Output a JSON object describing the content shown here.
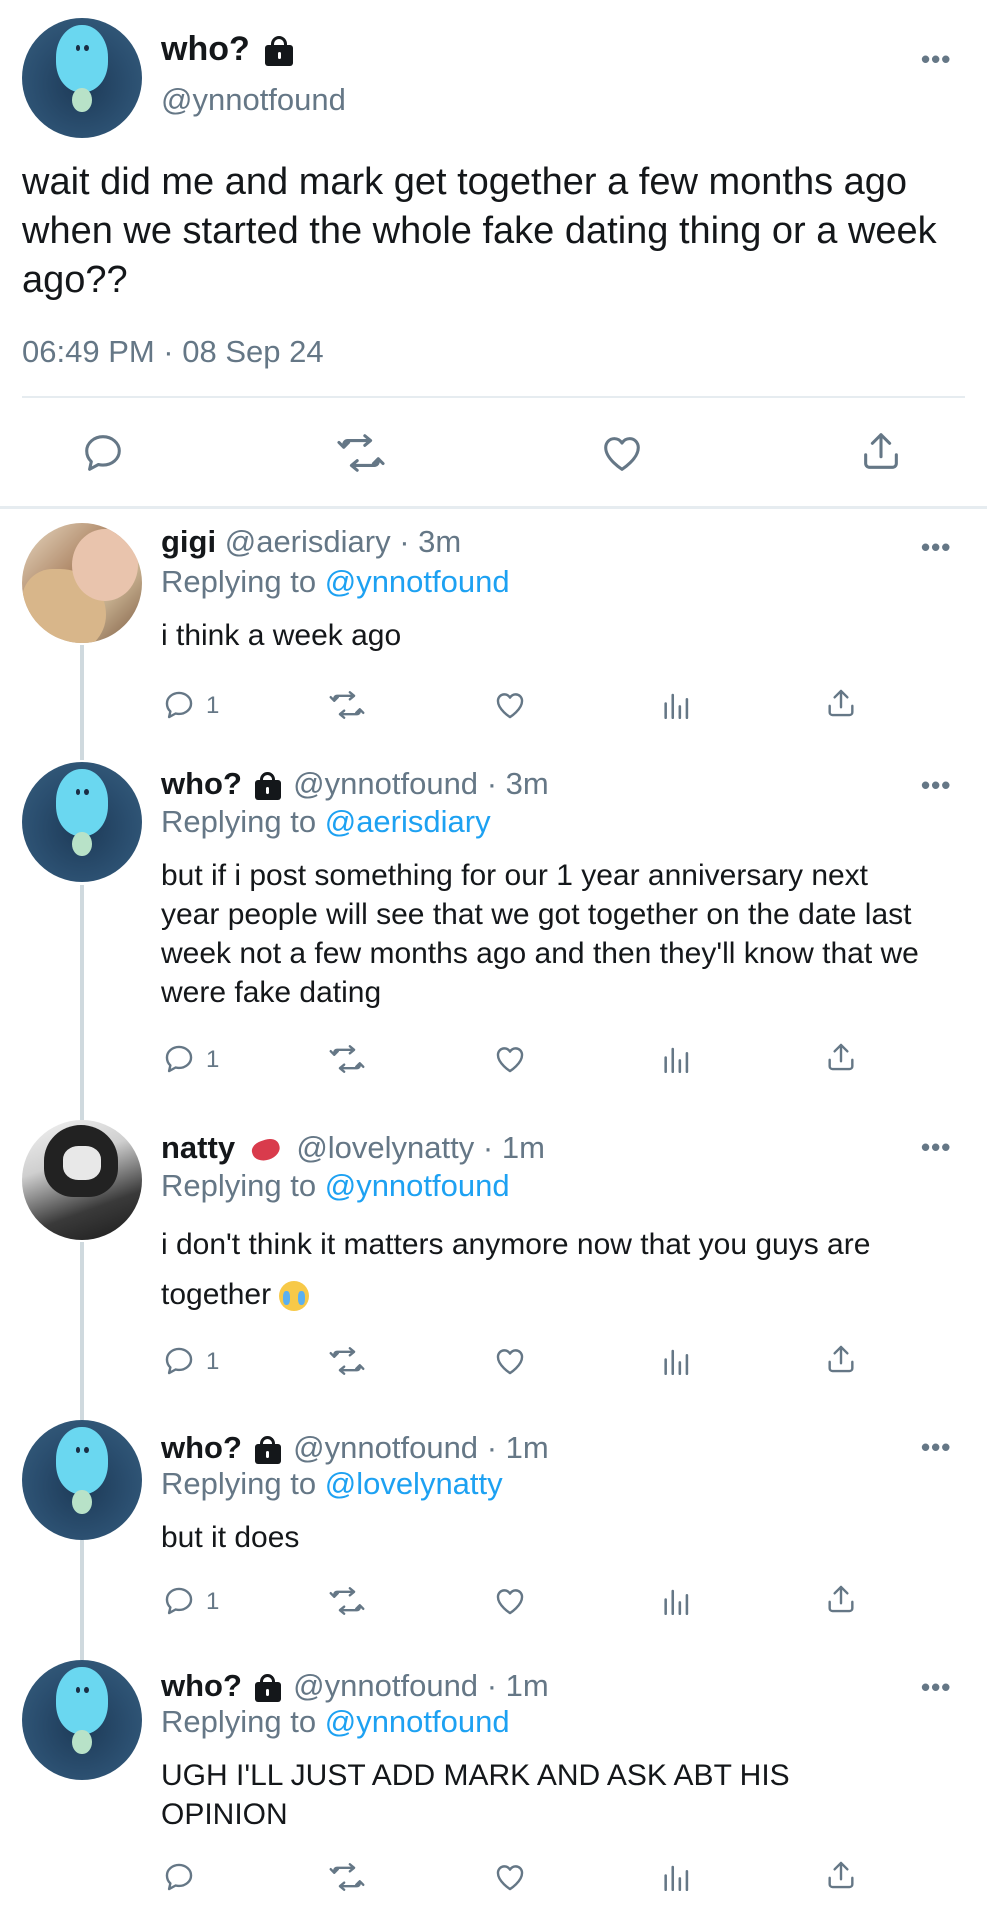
{
  "main_tweet": {
    "display_name": "who?",
    "handle": "@ynnotfound",
    "text": "wait did me and mark get together a few months ago when we started the whole fake dating thing or a week ago??",
    "timestamp": "06:49 PM · 08 Sep 24",
    "more_label": "•••",
    "actions": [
      "reply-icon",
      "retweet-icon",
      "like-icon",
      "share-icon"
    ]
  },
  "replies": [
    {
      "display_name": "gigi",
      "handle": "@aerisdiary",
      "age": "· 3m",
      "replying_prefix": "Replying to",
      "replying_to": "@ynnotfound",
      "text": "i think a week ago",
      "reply_count": "1",
      "more_label": "•••"
    },
    {
      "display_name": "who?",
      "handle": "@ynnotfound",
      "age": "· 3m",
      "replying_prefix": "Replying to",
      "replying_to": "@aerisdiary",
      "text": "but if i post something for our 1 year anniversary next year people will see that we got together on the date last week not a few months ago and then they'll know that we were fake dating",
      "reply_count": "1",
      "more_label": "•••"
    },
    {
      "display_name": "natty",
      "handle": "@lovelynatty",
      "age": "· 1m",
      "replying_prefix": "Replying to",
      "replying_to": "@ynnotfound",
      "text": "i don't think it matters anymore now that you guys are together",
      "reply_count": "1",
      "more_label": "•••"
    },
    {
      "display_name": "who?",
      "handle": "@ynnotfound",
      "age": "· 1m",
      "replying_prefix": "Replying to",
      "replying_to": "@lovelynatty",
      "text": "but it does",
      "reply_count": "1",
      "more_label": "•••"
    },
    {
      "display_name": "who?",
      "handle": "@ynnotfound",
      "age": "· 1m",
      "replying_prefix": "Replying to",
      "replying_to": "@ynnotfound",
      "text": "UGH I'LL JUST ADD MARK AND ASK ABT HIS OPINION",
      "reply_count": "",
      "more_label": "•••"
    }
  ],
  "colors": {
    "link_blue": "#1da1f2",
    "muted_gray": "#657786",
    "text_dark": "#14171a",
    "avatar_cyan": "#6ad7f0",
    "divider": "#e6ecf0"
  }
}
